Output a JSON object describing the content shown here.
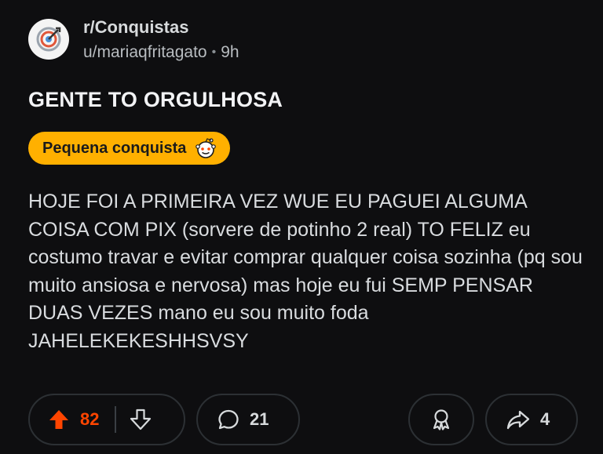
{
  "post": {
    "subreddit": "r/Conquistas",
    "username": "u/mariaqfritagato",
    "separator": "•",
    "age": "9h",
    "title": "GENTE TO ORGULHOSA",
    "flair": "Pequena conquista",
    "body": "HOJE FOI A PRIMEIRA VEZ WUE EU PAGUEI ALGUMA COISA COM PIX (sorvere de potinho 2 real) TO FELIZ eu costumo travar e evitar comprar qualquer coisa sozinha (pq sou muito ansiosa e nervosa) mas hoje eu fui SEMP PENSAR DUAS VEZES mano eu sou muito foda JAHELEKEKESHHSVSY"
  },
  "actions": {
    "upvotes": "82",
    "comments": "21",
    "shares": "4"
  },
  "icons": {
    "avatar": "target-icon",
    "flair": "snoo-icon",
    "upvote": "upvote-arrow-icon",
    "downvote": "downvote-arrow-icon",
    "comment": "comment-bubble-icon",
    "award": "award-icon",
    "share": "share-arrow-icon"
  },
  "colors": {
    "background": "#0e0e10",
    "upvote_active": "#ff4500",
    "flair_bg": "#ffb000"
  }
}
